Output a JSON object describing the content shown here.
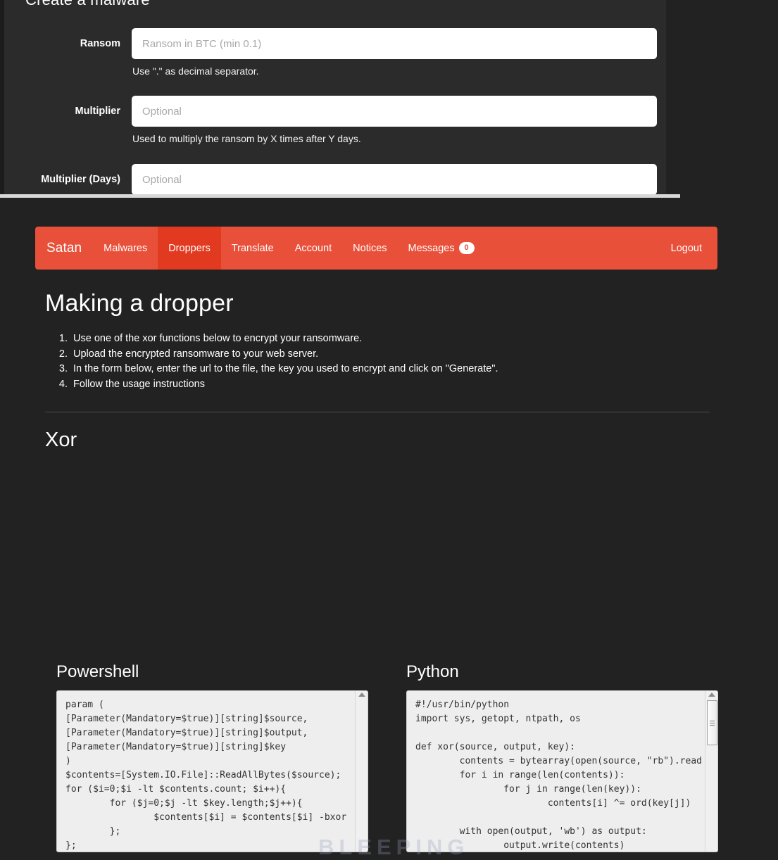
{
  "top_panel": {
    "title": "Create a malware",
    "fields": [
      {
        "label": "Ransom",
        "placeholder": "Ransom in BTC (min 0.1)",
        "value": "",
        "help": "Use \".\" as decimal separator."
      },
      {
        "label": "Multiplier",
        "placeholder": "Optional",
        "value": "",
        "help": "Used to multiply the ransom by X times after Y days."
      },
      {
        "label": "Multiplier (Days)",
        "placeholder": "Optional",
        "value": "",
        "help": ""
      }
    ]
  },
  "navbar": {
    "brand": "Satan",
    "items": [
      {
        "label": "Malwares",
        "active": false
      },
      {
        "label": "Droppers",
        "active": true
      },
      {
        "label": "Translate",
        "active": false
      },
      {
        "label": "Account",
        "active": false
      },
      {
        "label": "Notices",
        "active": false
      },
      {
        "label": "Messages",
        "active": false,
        "badge": "0"
      }
    ],
    "logout": "Logout",
    "colors": {
      "bar": "#e8503a",
      "active": "#e23a20",
      "badge_text": "#e8503a"
    }
  },
  "main": {
    "title": "Making a dropper",
    "steps": [
      "Use one of the xor functions below to encrypt your ransomware.",
      "Upload the encrypted ransomware to your web server.",
      "In the form below, enter the url to the file, the key you used to encrypt and click on \"Generate\".",
      "Follow the usage instructions"
    ],
    "section_title": "Xor",
    "code_blocks": [
      {
        "heading": "Powershell",
        "code": "param (\n[Parameter(Mandatory=$true)][string]$source,\n[Parameter(Mandatory=$true)][string]$output,\n[Parameter(Mandatory=$true)][string]$key\n)\n$contents=[System.IO.File]::ReadAllBytes($source);\nfor ($i=0;$i -lt $contents.count; $i++){\n        for ($j=0;$j -lt $key.length;$j++){\n                $contents[$i] = $contents[$i] -bxor\n        };\n};"
      },
      {
        "heading": "Python",
        "code": "#!/usr/bin/python\nimport sys, getopt, ntpath, os\n\ndef xor(source, output, key):\n        contents = bytearray(open(source, \"rb\").read\n        for i in range(len(contents)):\n                for j in range(len(key)):\n                        contents[i] ^= ord(key[j])\n\n        with open(output, 'wb') as output:\n                output.write(contents)"
      }
    ]
  },
  "watermark": "BLEEPING"
}
